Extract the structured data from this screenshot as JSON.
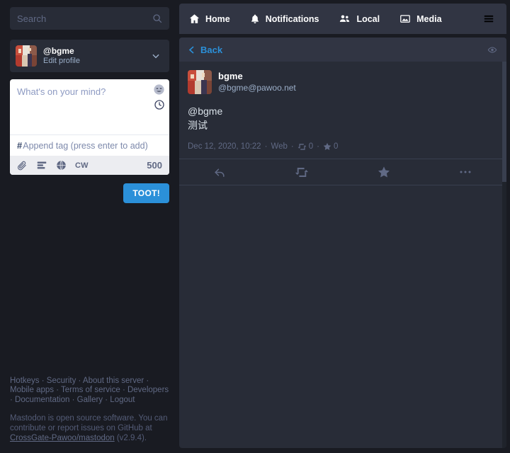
{
  "colors": {
    "accent": "#2b90d9",
    "page_bg": "#191b22",
    "panel_bg": "#282c37",
    "header_bg": "#313543",
    "text_muted": "#606984",
    "text_light": "#9baec8"
  },
  "search": {
    "placeholder": "Search",
    "value": "",
    "icon": "search-icon"
  },
  "profile": {
    "name": "@bgme",
    "edit_label": "Edit profile",
    "chevron_icon": "chevron-down-icon",
    "avatar_icon": "avatar"
  },
  "compose": {
    "placeholder": "What's on your mind?",
    "value": "",
    "emoji_icon": "emoji-picker-icon",
    "schedule_icon": "clock-icon",
    "tag_hash": "#",
    "tag_placeholder": "Append tag (press enter to add)",
    "tag_value": "",
    "toolbar": {
      "attach_icon": "paperclip-icon",
      "poll_icon": "poll-icon",
      "visibility_icon": "globe-icon",
      "cw_label": "CW",
      "char_count": "500"
    },
    "submit_label": "TOOT!"
  },
  "footer": {
    "links": [
      "Hotkeys",
      "Security",
      "About this server",
      "Mobile apps",
      "Terms of service",
      "Developers",
      "Documentation",
      "Gallery",
      "Logout"
    ],
    "note_before": "Mastodon is open source software. You can contribute or report issues on GitHub at ",
    "note_link": "CrossGate-Pawoo/mastodon",
    "note_after": " (v2.9.4)."
  },
  "nav": {
    "tabs": [
      {
        "label": "Home",
        "icon": "home-icon"
      },
      {
        "label": "Notifications",
        "icon": "bell-icon"
      },
      {
        "label": "Local",
        "icon": "users-icon"
      },
      {
        "label": "Media",
        "icon": "image-icon"
      }
    ],
    "menu_icon": "hamburger-menu-icon"
  },
  "column": {
    "back_label": "Back",
    "back_icon": "chevron-left-icon",
    "eye_icon": "eye-icon"
  },
  "status": {
    "display_name": "bgme",
    "acct": "@bgme@pawoo.net",
    "avatar_icon": "avatar",
    "content_mention": "@bgme",
    "content_text": "测试",
    "timestamp": "Dec 12, 2020, 10:22",
    "app": "Web",
    "boost_icon": "boost-icon",
    "boost_count": "0",
    "fav_icon": "star-icon",
    "fav_count": "0",
    "actions": [
      {
        "name": "reply-button",
        "icon": "reply-icon"
      },
      {
        "name": "boost-button",
        "icon": "boost-icon"
      },
      {
        "name": "favourite-button",
        "icon": "star-icon"
      },
      {
        "name": "more-button",
        "icon": "ellipsis-icon"
      }
    ]
  }
}
